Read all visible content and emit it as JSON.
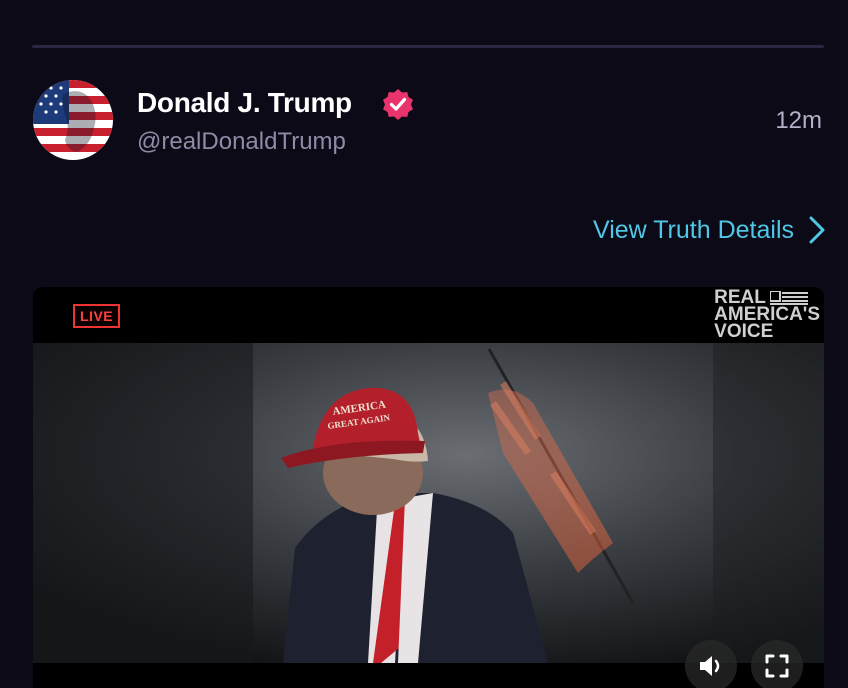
{
  "post": {
    "author_name": "Donald J. Trump",
    "author_handle": "@realDonaldTrump",
    "timestamp": "12m",
    "avatar_icon": "flag-portrait-avatar",
    "verified_icon": "verified-badge-icon",
    "view_details_label": "View Truth Details"
  },
  "video": {
    "live_label": "LIVE",
    "logo_line1": "REAL",
    "logo_line2": "AMERICA'S",
    "logo_line3": "VOICE",
    "hat_text_line1": "AMERICA",
    "hat_text_line2": "GREAT AGAIN",
    "sound_icon": "speaker-icon",
    "fullscreen_icon": "fullscreen-icon"
  },
  "colors": {
    "background": "#0d0a17",
    "link": "#4fc7e6",
    "verified": "#e8336d",
    "live": "#ff4040"
  }
}
